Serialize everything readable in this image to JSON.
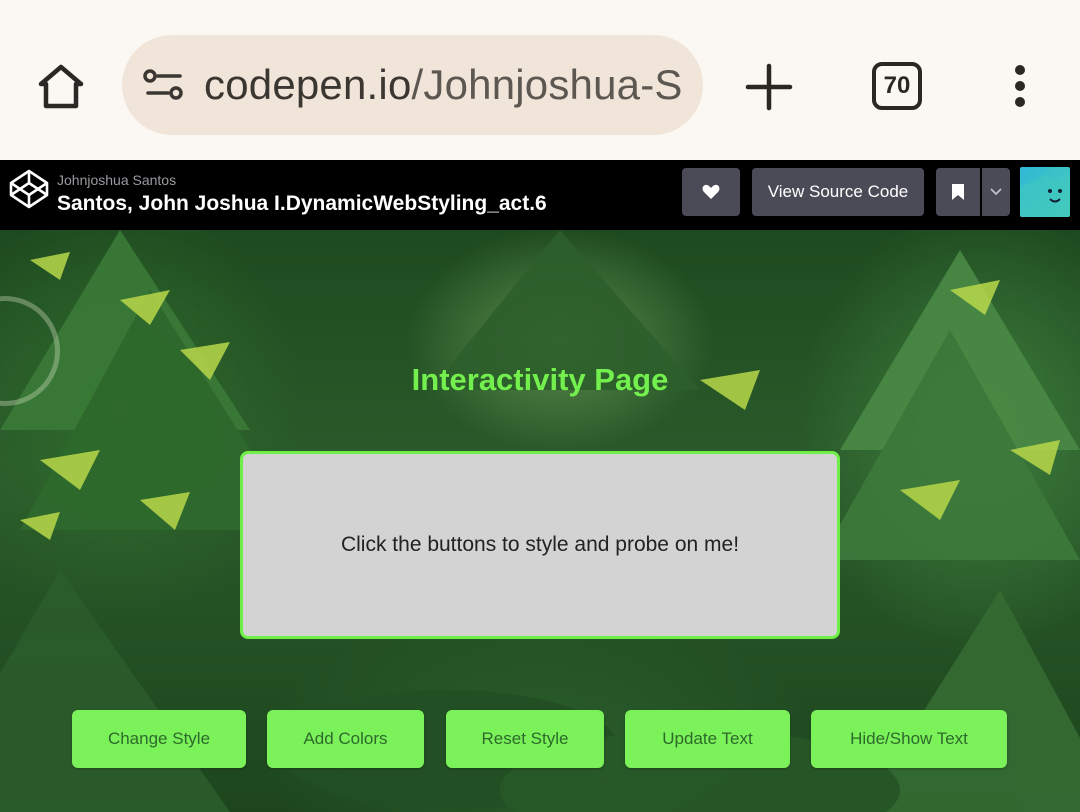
{
  "browser": {
    "url_host": "codepen.io",
    "url_path": "/Johnjoshua-S",
    "tab_count": "70",
    "icons": {
      "home": "home-icon",
      "site_settings": "tune-icon",
      "new_tab": "plus-icon",
      "menu": "more-vert-icon"
    }
  },
  "codepen": {
    "author": "Johnjoshua Santos",
    "title": "Santos, John Joshua I.DynamicWebStyling_act.6",
    "view_source_label": "View Source Code",
    "icons": {
      "logo": "codepen-logo-icon",
      "like": "heart-icon",
      "bookmark": "bookmark-icon",
      "caret": "chevron-down-icon"
    }
  },
  "page": {
    "heading": "Interactivity Page",
    "box_text": "Click the buttons to style and probe on me!",
    "buttons": [
      {
        "label": "Change Style"
      },
      {
        "label": "Add Colors"
      },
      {
        "label": "Reset Style"
      },
      {
        "label": "Update Text"
      },
      {
        "label": "Hide/Show Text"
      }
    ]
  },
  "colors": {
    "accent_green": "#7bf15a",
    "heading_green": "#73f04d",
    "box_bg": "#d3d3d3",
    "codepen_bar": "#000000",
    "button_gray": "#4a4b57"
  }
}
